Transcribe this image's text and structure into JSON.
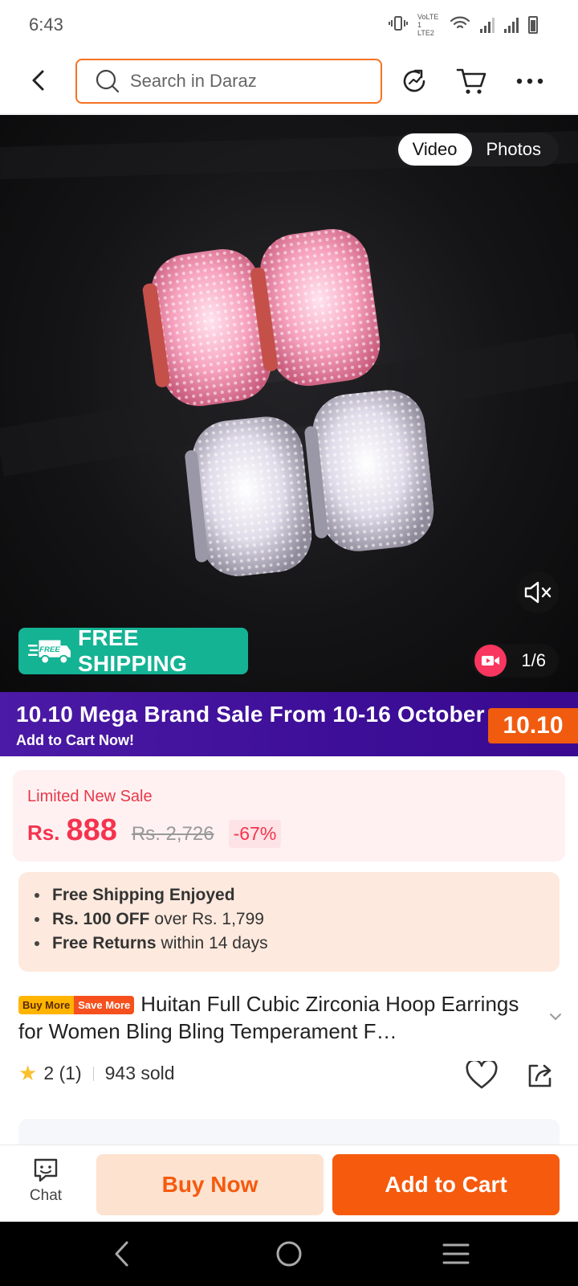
{
  "status_bar": {
    "time": "6:43",
    "network_label": "VoLTE 1 LTE2"
  },
  "search": {
    "placeholder": "Search in Daraz"
  },
  "media": {
    "toggle": [
      "Video",
      "Photos"
    ],
    "active_toggle": "Video",
    "free_shipping_label": "FREE SHIPPING",
    "free_shipping_truck_text": "FREE",
    "counter": "1/6"
  },
  "promo": {
    "title": "10.10 Mega Brand Sale From 10-16 October",
    "subtitle": "Add to Cart Now!",
    "badge": "10.10"
  },
  "price": {
    "sale_label": "Limited New Sale",
    "currency": "Rs.",
    "current": "888",
    "original": "Rs. 2,726",
    "discount": "-67%"
  },
  "benefits": [
    {
      "bold": "Free Shipping Enjoyed",
      "rest": ""
    },
    {
      "bold": "Rs. 100 OFF",
      "rest": "over Rs. 1,799"
    },
    {
      "bold": "Free Returns",
      "rest": "within 14 days"
    }
  ],
  "product": {
    "tag_buy_more": "Buy More",
    "tag_save_more": "Save More",
    "title": "Huitan Full Cubic Zirconia Hoop Earrings for Women Bling Bling Temperament F…",
    "rating": "2 (1)",
    "sold": "943 sold"
  },
  "actions": {
    "chat": "Chat",
    "buy_now": "Buy Now",
    "add_to_cart": "Add to Cart"
  },
  "colors": {
    "accent": "#f57224",
    "brand_orange": "#f55a0d",
    "price_red": "#f5334e",
    "promo_purple": "#3d0e97",
    "free_ship_green": "#14b394"
  }
}
